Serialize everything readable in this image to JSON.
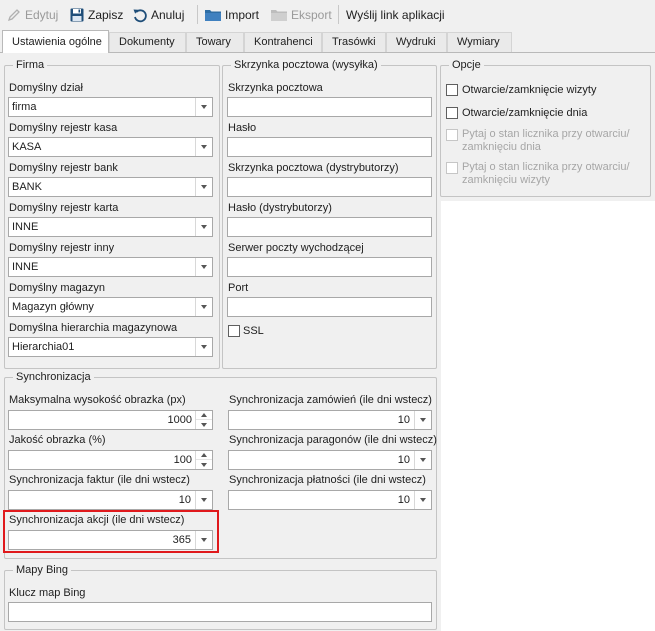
{
  "toolbar": {
    "edit_label": "Edytuj",
    "save_label": "Zapisz",
    "cancel_label": "Anuluj",
    "import_label": "Import",
    "export_label": "Eksport",
    "send_link_label": "Wyślij link aplikacji"
  },
  "tabs": [
    {
      "label": "Ustawienia ogólne"
    },
    {
      "label": "Dokumenty"
    },
    {
      "label": "Towary"
    },
    {
      "label": "Kontrahenci"
    },
    {
      "label": "Trasówki"
    },
    {
      "label": "Wydruki"
    },
    {
      "label": "Wymiary"
    }
  ],
  "firma": {
    "title": "Firma",
    "dzial": {
      "label": "Domyślny dział",
      "value": "firma"
    },
    "kasa": {
      "label": "Domyślny rejestr kasa",
      "value": "KASA"
    },
    "bank": {
      "label": "Domyślny rejestr bank",
      "value": "BANK"
    },
    "karta": {
      "label": "Domyślny rejestr karta",
      "value": "INNE"
    },
    "inny": {
      "label": "Domyślny rejestr inny",
      "value": "INNE"
    },
    "magazyn": {
      "label": "Domyślny magazyn",
      "value": "Magazyn główny"
    },
    "hierarchia": {
      "label": "Domyślna hierarchia magazynowa",
      "value": "Hierarchia01"
    }
  },
  "skrzynka": {
    "title": "Skrzynka pocztowa (wysyłka)",
    "mailbox_label": "Skrzynka pocztowa",
    "password_label": "Hasło",
    "mailbox_dist_label": "Skrzynka pocztowa (dystrybutorzy)",
    "password_dist_label": "Hasło (dystrybutorzy)",
    "smtp_label": "Serwer poczty wychodzącej",
    "port_label": "Port",
    "ssl_label": "SSL"
  },
  "opcje": {
    "title": "Opcje",
    "open_close_visit": "Otwarcie/zamknięcie wizyty",
    "open_close_day": "Otwarcie/zamknięcie dnia",
    "ask_counter_day_1": "Pytaj o stan licznika przy otwarciu/",
    "ask_counter_day_2": "zamknięciu dnia",
    "ask_counter_visit_1": "Pytaj o stan licznika przy otwarciu/",
    "ask_counter_visit_2": "zamknięciu wizyty"
  },
  "sync": {
    "title": "Synchronizacja",
    "max_height": {
      "label": "Maksymalna wysokość obrazka (px)",
      "value": "1000"
    },
    "quality": {
      "label": "Jakość obrazka (%)",
      "value": "100"
    },
    "invoices": {
      "label": "Synchronizacja faktur (ile dni wstecz)",
      "value": "10"
    },
    "promotions": {
      "label": "Synchronizacja akcji (ile dni wstecz)",
      "value": "365"
    },
    "orders": {
      "label": "Synchronizacja zamówień (ile dni wstecz)",
      "value": "10"
    },
    "receipts": {
      "label": "Synchronizacja paragonów (ile dni wstecz)",
      "value": "10"
    },
    "payments": {
      "label": "Synchronizacja płatności (ile dni wstecz)",
      "value": "10"
    }
  },
  "bing": {
    "title": "Mapy Bing",
    "key_label": "Klucz map Bing"
  },
  "colors": {
    "highlight": "#e0191c",
    "save_icon": "#1f4e79",
    "folder_icon": "#2e6da4"
  }
}
